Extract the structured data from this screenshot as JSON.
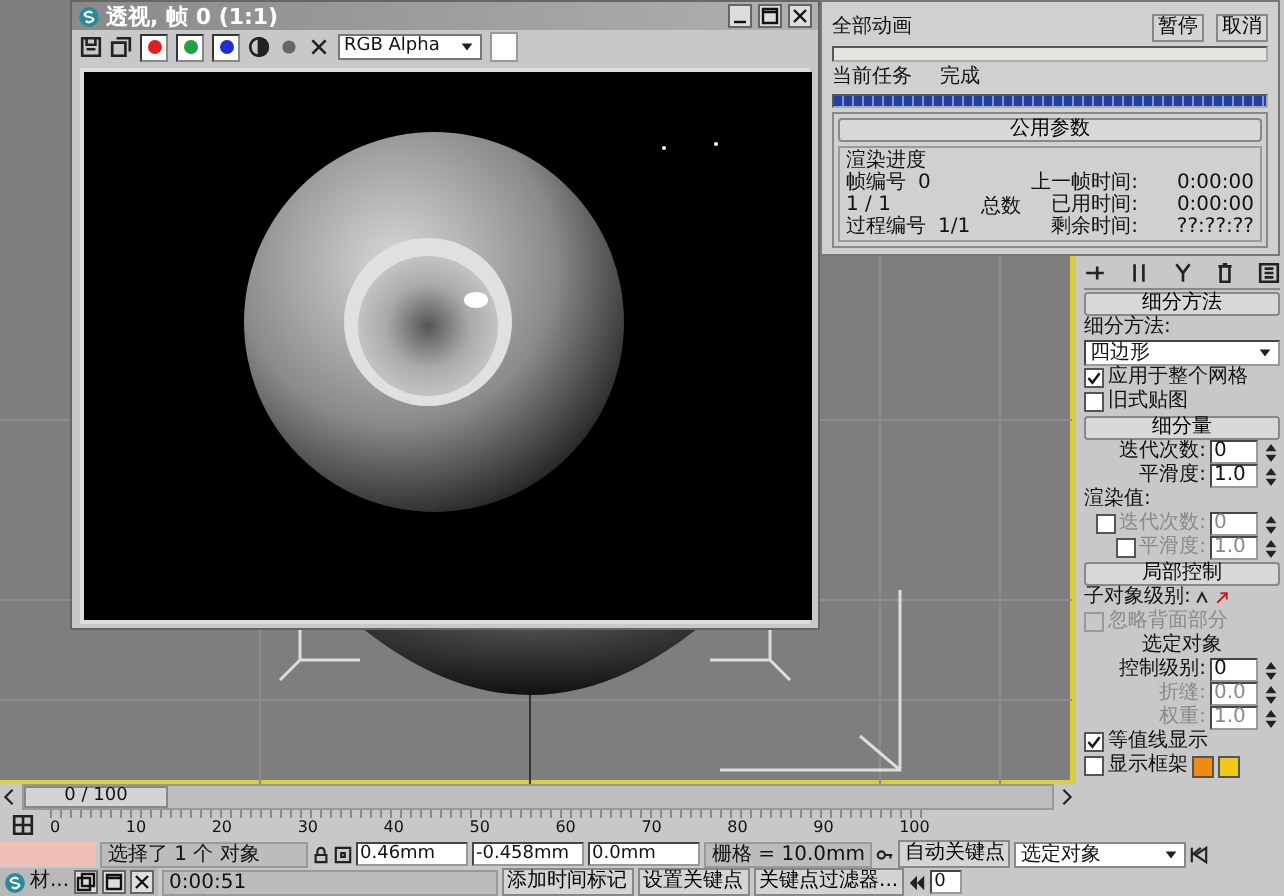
{
  "render_window": {
    "title": "透视, 帧 0 (1:1)",
    "channels": [
      {
        "color": "#e02020",
        "selected": true
      },
      {
        "color": "#20a040",
        "selected": true
      },
      {
        "color": "#2030d0",
        "selected": true
      }
    ],
    "channel_dropdown": "RGB Alpha"
  },
  "progress_dialog": {
    "all_label": "全部动画",
    "buttons": [
      "暂停",
      "取消"
    ],
    "overall": {
      "level": 0
    },
    "task_label": "当前任务",
    "task_value": "完成",
    "task": {
      "level": 1
    },
    "rollout": "公用参数",
    "group": "渲染进度",
    "left": [
      {
        "label": "帧编号",
        "value": "0"
      },
      {
        "label": "1 / 1"
      },
      {
        "label": "过程编号",
        "value": "1/1"
      }
    ],
    "middle": "总数",
    "right": [
      {
        "label": "上一帧时间:",
        "value": "0:00:00"
      },
      {
        "label": "已用时间:",
        "value": "0:00:00"
      },
      {
        "label": "剩余时间:",
        "value": "??:??:??"
      }
    ]
  },
  "command_panel": {
    "rollouts": [
      {
        "title": "细分方法",
        "rows": [
          {
            "kind": "label",
            "text": "细分方法:"
          },
          {
            "kind": "dropdown",
            "value": "四边形"
          },
          {
            "kind": "checkbox",
            "label": "应用于整个网格",
            "checked": true,
            "disabled": false
          },
          {
            "kind": "checkbox",
            "label": "旧式贴图",
            "checked": false,
            "disabled": false
          }
        ]
      },
      {
        "title": "细分量",
        "rows": [
          {
            "kind": "spinner",
            "label": "迭代次数:",
            "value": "0",
            "disabled": false
          },
          {
            "kind": "spinner",
            "label": "平滑度:",
            "value": "1.0",
            "disabled": false
          },
          {
            "kind": "label",
            "text": "渲染值:"
          },
          {
            "kind": "check_spinner",
            "label": "迭代次数:",
            "value": "0",
            "disabled": true,
            "checked": false
          },
          {
            "kind": "check_spinner",
            "label": "平滑度:",
            "value": "1.0",
            "disabled": true,
            "checked": false
          }
        ]
      },
      {
        "title": "局部控制",
        "rows": [
          {
            "kind": "label_icons",
            "text": "子对象级别:"
          },
          {
            "kind": "checkbox",
            "label": "忽略背面部分",
            "checked": false,
            "disabled": true
          },
          {
            "kind": "center_label",
            "text": "选定对象"
          },
          {
            "kind": "spinner",
            "label": "控制级别:",
            "value": "0",
            "disabled": false
          },
          {
            "kind": "spinner",
            "label": "折缝:",
            "value": "0.0",
            "disabled": true
          },
          {
            "kind": "spinner",
            "label": "权重:",
            "value": "1.0",
            "disabled": true
          },
          {
            "kind": "checkbox",
            "label": "等值线显示",
            "checked": true,
            "disabled": false
          },
          {
            "kind": "swatch_checkbox",
            "label": "显示框架",
            "checked": false,
            "disabled": false,
            "swatches": [
              {
                "color": "#f08a10"
              },
              {
                "color": "#f0c818"
              }
            ]
          }
        ]
      }
    ]
  },
  "time_slider": {
    "label": "0 / 100",
    "level": 0
  },
  "ticks": [
    "0",
    "10",
    "20",
    "30",
    "40",
    "50",
    "60",
    "70",
    "80",
    "90",
    "100"
  ],
  "status": {
    "selection": "选择了 1 个 对象",
    "x": "0.46mm",
    "y": "-0.458mm",
    "z": "0.0mm",
    "grid": "栅格 = 10.0mm",
    "auto_key": "自动关键点",
    "key_dropdown": "选定对象",
    "set_key": "设置关键点",
    "key_filters": "关键点过滤器...",
    "task_window": "材...",
    "time": "0:00:51",
    "add_tag": "添加时间标记",
    "frame": "0"
  }
}
